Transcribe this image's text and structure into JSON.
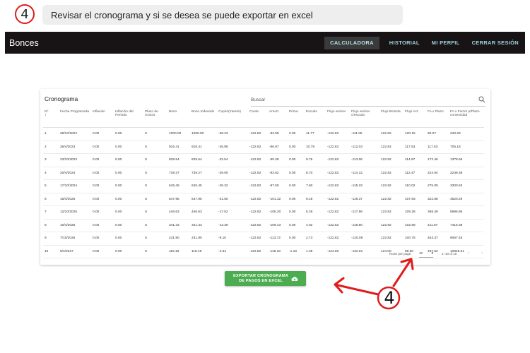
{
  "instruction": {
    "step": "4",
    "text": "Revisar el cronograma y si se desea se puede exportar en excel"
  },
  "appbar": {
    "brand": "Bonces",
    "nav": [
      "CALCULADORA",
      "HISTORIAL",
      "MI PERFIL",
      "CERRAR SESIÓN"
    ]
  },
  "card": {
    "title": "Cronograma",
    "search_placeholder": "Buscar",
    "headers": [
      "Nº",
      "Fecha Programada",
      "Inflación",
      "Inflación del Periodo",
      "Plazo de Gracia",
      "Bono",
      "Bono Indexado",
      "Cupón(Interés)",
      "Cuota",
      "Amort.",
      "Prima",
      "Escudo",
      "Flujo emisor",
      "Flujo emisor c/escudo",
      "Flujo Bonista",
      "Flujo Act.",
      "FA x Plazo",
      "FA x Factor p/Plazo convexidad"
    ],
    "rows": [
      [
        "1",
        "28/10/2022",
        "0.00",
        "0.00",
        "S",
        "1000.00",
        "1000.00",
        "-39.23",
        "-122.82",
        "-83.59",
        "0.00",
        "11.77",
        "-122.82",
        "-111.05",
        "122.82",
        "120.15",
        "60.07",
        "240.29"
      ],
      [
        "2",
        "26/4/2023",
        "0.00",
        "0.00",
        "S",
        "916.41",
        "916.41",
        "-35.95",
        "-122.82",
        "-86.87",
        "0.00",
        "10.79",
        "-122.82",
        "-112.03",
        "122.82",
        "117.53",
        "117.53",
        "705.18"
      ],
      [
        "3",
        "23/10/2023",
        "0.00",
        "0.00",
        "S",
        "829.54",
        "829.54",
        "-32.54",
        "-122.82",
        "-90.28",
        "0.00",
        "9.76",
        "-122.82",
        "-113.06",
        "122.82",
        "114.97",
        "172.46",
        "1379.66"
      ],
      [
        "4",
        "20/4/2024",
        "0.00",
        "0.00",
        "S",
        "739.27",
        "739.27",
        "-29.00",
        "-122.82",
        "-93.82",
        "0.00",
        "8.70",
        "-122.82",
        "-114.12",
        "122.82",
        "112.47",
        "224.94",
        "2249.38"
      ],
      [
        "5",
        "17/10/2024",
        "0.00",
        "0.00",
        "S",
        "645.45",
        "645.45",
        "-25.32",
        "-122.82",
        "-97.50",
        "0.00",
        "7.60",
        "-122.82",
        "-115.22",
        "122.82",
        "110.02",
        "275.05",
        "3300.63"
      ],
      [
        "6",
        "15/4/2025",
        "0.00",
        "0.00",
        "S",
        "547.95",
        "547.95",
        "-21.50",
        "-122.82",
        "-101.32",
        "0.00",
        "6.45",
        "-122.82",
        "-116.37",
        "122.82",
        "107.63",
        "322.88",
        "4520.29"
      ],
      [
        "7",
        "12/10/2025",
        "0.00",
        "0.00",
        "S",
        "446.63",
        "446.63",
        "-17.52",
        "-122.82",
        "-105.30",
        "0.00",
        "5.26",
        "-122.82",
        "-117.56",
        "122.82",
        "105.28",
        "368.49",
        "5895.86"
      ],
      [
        "8",
        "10/4/2026",
        "0.00",
        "0.00",
        "S",
        "341.33",
        "341.33",
        "-13.39",
        "-122.82",
        "-109.43",
        "0.00",
        "4.02",
        "-122.82",
        "-118.80",
        "122.82",
        "102.99",
        "411.97",
        "7415.38"
      ],
      [
        "9",
        "7/10/2026",
        "0.00",
        "0.00",
        "S",
        "231.90",
        "231.90",
        "-9.10",
        "-122.82",
        "-113.72",
        "0.00",
        "2.73",
        "-122.82",
        "-120.09",
        "122.82",
        "100.75",
        "453.37",
        "9067.45"
      ],
      [
        "10",
        "5/4/2027",
        "0.00",
        "0.00",
        "S",
        "118.18",
        "118.18",
        "-4.64",
        "-122.82",
        "-118.18",
        "-1.18",
        "1.39",
        "-124.00",
        "-122.61",
        "124.00",
        "99.50",
        "497.52",
        "10945.51"
      ]
    ],
    "pagination": {
      "rows_per_page_label": "Rows per page:",
      "rows_per_page_value": "10",
      "range": "1–10 of 10"
    }
  },
  "export_button": {
    "label_line1": "EXPORTAR CRONOGRAMA",
    "label_line2": "DE PAGOS EN EXCEL"
  },
  "annotation": {
    "number": "4",
    "color": "#e01b1b"
  },
  "colors": {
    "appbar": "#181314",
    "nav_text": "#9ed1dd",
    "export_green": "#4bad50"
  }
}
